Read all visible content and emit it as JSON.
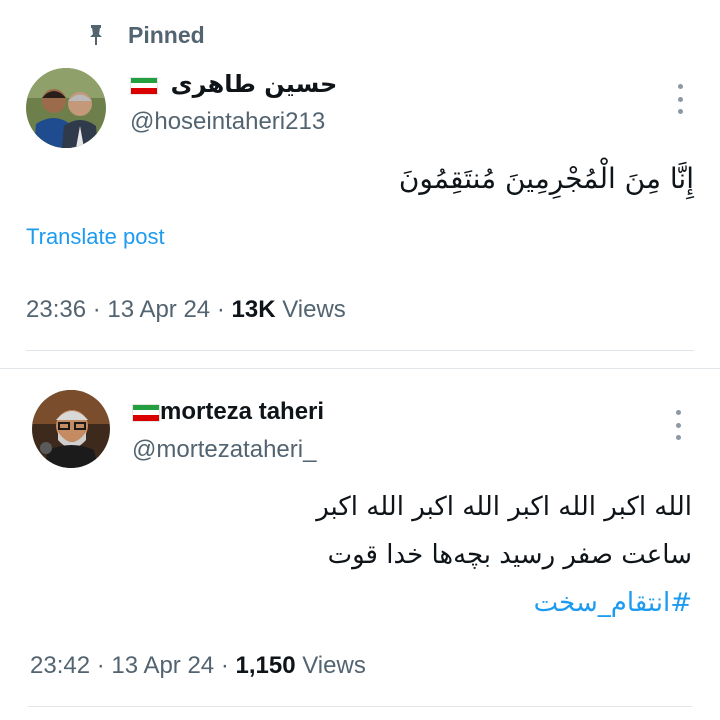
{
  "pinned": {
    "label": "Pinned",
    "icon": "pin-icon"
  },
  "tweet1": {
    "display_name": "حسین طاهری",
    "handle": "@hoseintaheri213",
    "text": "إِنَّا مِنَ الْمُجْرِمِينَ مُنتَقِمُونَ",
    "translate_label": "Translate post",
    "time": "23:36",
    "date": "13 Apr 24",
    "views_count": "13K",
    "views_label": "Views"
  },
  "tweet2": {
    "display_name": "morteza taheri",
    "handle": "@mortezataheri_",
    "lines": [
      "الله اکبر الله اکبر الله اکبر الله اکبر",
      "ساعت صفر رسید بچه‌ها خدا قوت"
    ],
    "hashtag": "#انتقام_سخت",
    "time": "23:42",
    "date": "13 Apr 24",
    "views_count": "1,150",
    "views_label": "Views"
  },
  "colors": {
    "link": "#1d9bf0",
    "secondary_text": "#536471",
    "primary_text": "#0f1419",
    "flag_green": "#239f40",
    "flag_red": "#da0000"
  }
}
